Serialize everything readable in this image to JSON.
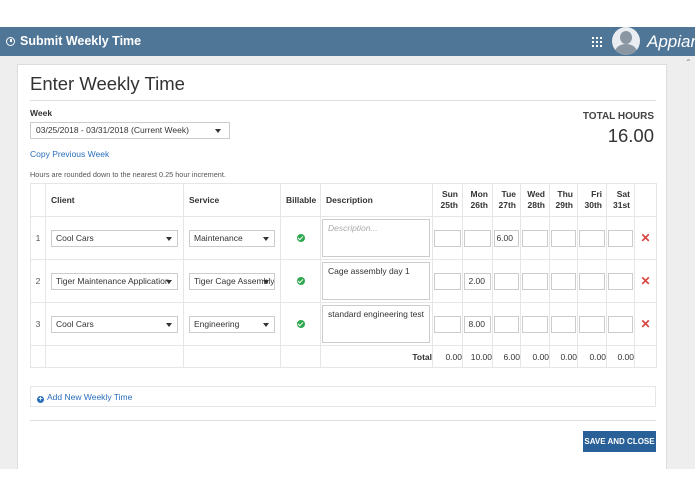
{
  "app": {
    "title": "Submit Weekly Time",
    "brand": "Appian"
  },
  "page": {
    "heading": "Enter Weekly Time"
  },
  "week": {
    "label": "Week",
    "selected": "03/25/2018 - 03/31/2018 (Current Week)",
    "copy_link": "Copy Previous Week"
  },
  "note": "Hours are rounded down to the nearest 0.25 hour increment.",
  "total_hours": {
    "label": "TOTAL HOURS",
    "value": "16.00"
  },
  "table": {
    "headers": {
      "client": "Client",
      "service": "Service",
      "billable": "Billable",
      "description": "Description"
    },
    "days": [
      {
        "name": "Sun",
        "date": "25th"
      },
      {
        "name": "Mon",
        "date": "26th"
      },
      {
        "name": "Tue",
        "date": "27th"
      },
      {
        "name": "Wed",
        "date": "28th"
      },
      {
        "name": "Thu",
        "date": "29th"
      },
      {
        "name": "Fri",
        "date": "30th"
      },
      {
        "name": "Sat",
        "date": "31st"
      }
    ],
    "rows": [
      {
        "num": "1",
        "client": "Cool Cars",
        "service": "Maintenance",
        "description": "",
        "description_placeholder": "Description...",
        "hours": [
          "",
          "",
          "6.00",
          "",
          "",
          "",
          ""
        ]
      },
      {
        "num": "2",
        "client": "Tiger Maintenance Application",
        "service": "Tiger Cage Assembly",
        "description": "Cage assembly day 1",
        "description_placeholder": "",
        "hours": [
          "",
          "2.00",
          "",
          "",
          "",
          "",
          ""
        ]
      },
      {
        "num": "3",
        "client": "Cool Cars",
        "service": "Engineering",
        "description": "standard engineering test",
        "description_placeholder": "",
        "hours": [
          "",
          "8.00",
          "",
          "",
          "",
          "",
          ""
        ]
      }
    ],
    "totals": {
      "label": "Total",
      "values": [
        "0.00",
        "10.00",
        "6.00",
        "0.00",
        "0.00",
        "0.00",
        "0.00"
      ]
    }
  },
  "add_link": "Add New Weekly Time",
  "save_button": "SAVE AND CLOSE",
  "icons": {
    "header": "clock-icon",
    "apps": "grid-icon",
    "billable": "check-circle-icon",
    "remove": "close-icon",
    "add": "plus-circle-icon"
  },
  "colors": {
    "header_bg": "#4f7597",
    "link": "#2a6ebb",
    "button_bg": "#2a6098",
    "check": "#2fa84f",
    "remove": "#d9443f"
  }
}
